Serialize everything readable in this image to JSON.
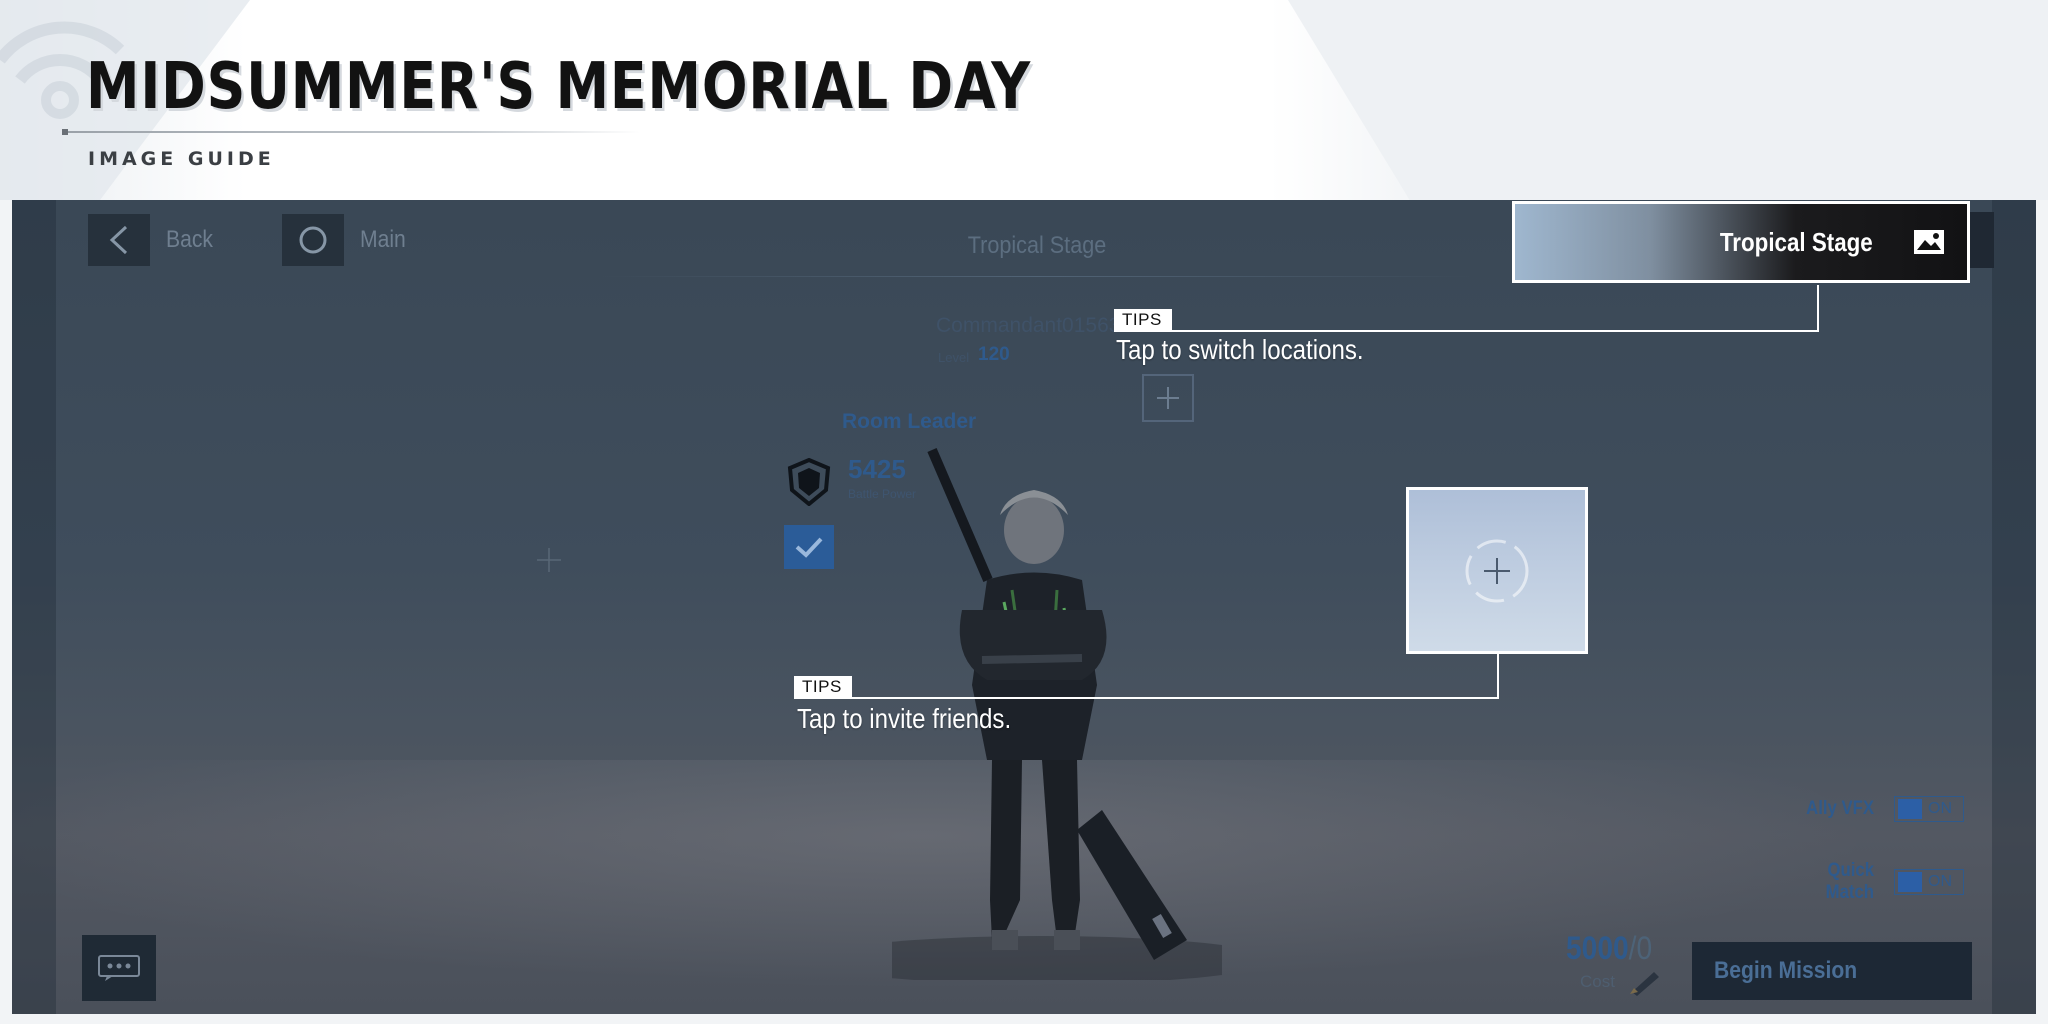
{
  "header": {
    "title": "MIDSUMMER'S MEMORIAL DAY",
    "subtitle": "IMAGE GUIDE"
  },
  "game": {
    "nav": {
      "back_label": "Back",
      "main_label": "Main"
    },
    "stage_title": "Tropical Stage",
    "commander": {
      "name": "Commandant01563",
      "level_label": "Level",
      "level": "120"
    },
    "room_leader": {
      "label": "Room Leader",
      "battle_power": "5425",
      "battle_power_label": "Battle Power"
    },
    "toggles": [
      {
        "label": "Ally VFX",
        "state": "ON"
      },
      {
        "label": "Quick Match",
        "state": "ON"
      }
    ],
    "cost": {
      "current": "5000",
      "separator": "/",
      "max": "0",
      "label": "Cost"
    },
    "begin_mission_label": "Begin Mission"
  },
  "highlight": {
    "stage_switch_label": "Tropical Stage"
  },
  "tips": [
    {
      "tag": "TIPS",
      "text": "Tap to switch locations."
    },
    {
      "tag": "TIPS",
      "text": "Tap to invite friends."
    }
  ],
  "icons": {
    "nav_back": "chevron-left-icon",
    "nav_main": "circle-icon",
    "stage_image": "image-icon",
    "chat": "chat-bubble-icon",
    "add": "plus-icon",
    "battle_power": "shield-icon",
    "check": "checkmark-icon",
    "cost": "pencil-icon"
  },
  "colors": {
    "overlay_dim": "#3f4d5c",
    "accent_blue": "#2f5a8c",
    "highlight_border": "#ffffff"
  }
}
